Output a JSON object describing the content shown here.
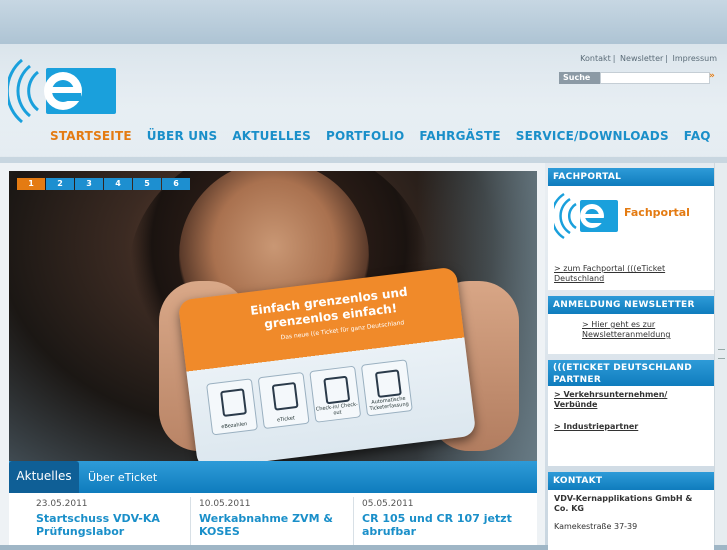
{
  "utility_nav": [
    "Kontakt",
    "Newsletter",
    "Impressum"
  ],
  "search": {
    "label": "Suche",
    "placeholder": ""
  },
  "main_nav": [
    {
      "label": "STARTSEITE",
      "active": true
    },
    {
      "label": "ÜBER UNS",
      "active": false
    },
    {
      "label": "AKTUELLES",
      "active": false
    },
    {
      "label": "PORTFOLIO",
      "active": false
    },
    {
      "label": "FAHRGÄSTE",
      "active": false
    },
    {
      "label": "SERVICE/DOWNLOADS",
      "active": false
    },
    {
      "label": "FAQ",
      "active": false
    }
  ],
  "slider": {
    "pages": [
      "1",
      "2",
      "3",
      "4",
      "5",
      "6"
    ],
    "active_page": "1",
    "card": {
      "title": "Einfach grenzenlos und grenzenlos einfach!",
      "subtitle": "Das neue ((e Ticket für ganz Deutschland",
      "icons": [
        {
          "label": "eBezahlen",
          "icon": "pay-icon"
        },
        {
          "label": "eTicket",
          "icon": "ticket-icon"
        },
        {
          "label": "Check-in/ Check-out",
          "icon": "checkin-icon"
        },
        {
          "label": "Automatische Ticketerfassung",
          "icon": "auto-icon"
        }
      ]
    }
  },
  "news": {
    "tabs": [
      "Aktuelles",
      "Über eTicket"
    ],
    "items": [
      {
        "date": "23.05.2011",
        "title": "Startschuss VDV-KA Prüfungslabor"
      },
      {
        "date": "10.05.2011",
        "title": "Werkabnahme ZVM & KOSES"
      },
      {
        "date": "05.05.2011",
        "title": "CR 105 und CR 107 jetzt abrufbar"
      }
    ]
  },
  "sidebar": {
    "fachportal": {
      "heading": "FACHPORTAL",
      "logo_text": "Fachportal",
      "link": "zum Fachportal (((eTicket Deutschland"
    },
    "newsletter": {
      "heading": "ANMELDUNG NEWSLETTER",
      "link": "Hier geht es zur Newsletteranmeldung"
    },
    "partner": {
      "heading": "(((ETICKET DEUTSCHLAND PARTNER",
      "links": [
        "Verkehrsunternehmen/ Verbünde",
        "Industriepartner"
      ]
    },
    "kontakt": {
      "heading": "KONTAKT",
      "company": "VDV-Kernapplikations GmbH & Co. KG",
      "street": "Kamekestraße 37-39"
    }
  },
  "colors": {
    "accent_blue": "#1a8fc9",
    "accent_orange": "#e47b12",
    "header_bar": "#0f7cbd"
  }
}
